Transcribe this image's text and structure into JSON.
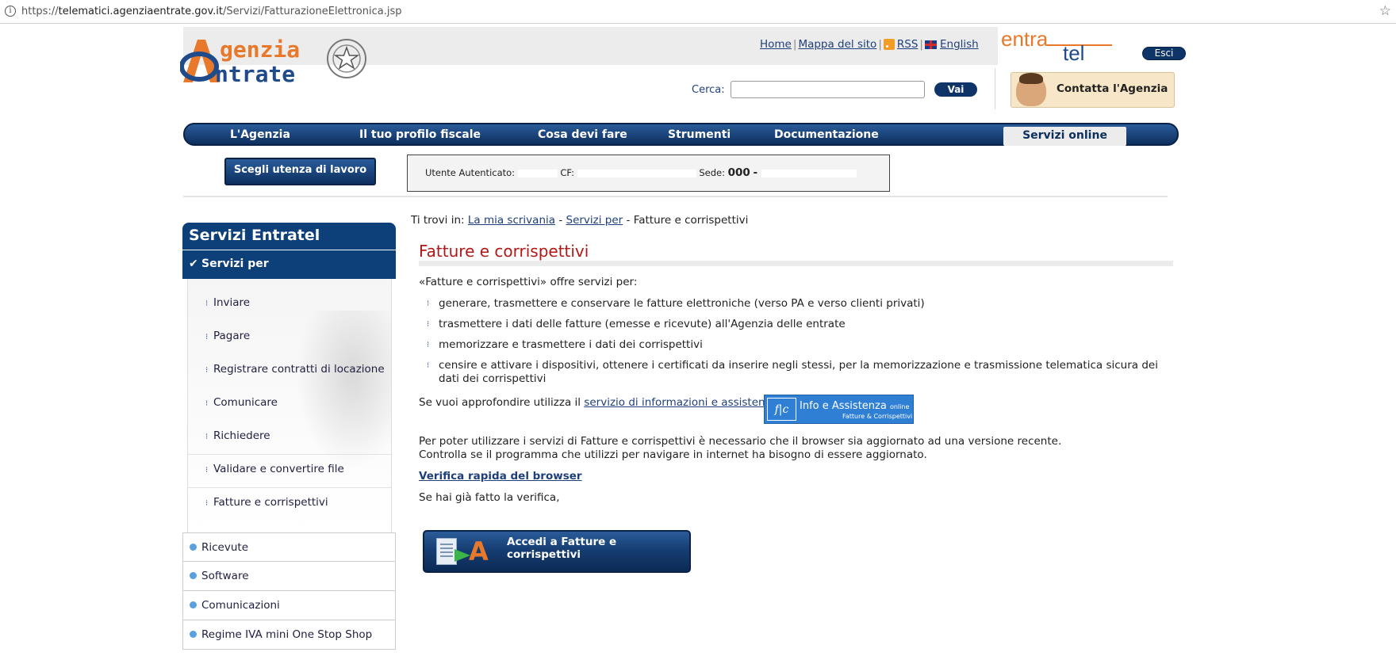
{
  "browser": {
    "url_scheme": "https://",
    "url_host": "telematici.agenziaentrate.gov.it",
    "url_path": "/Servizi/FatturazioneElettronica.jsp"
  },
  "logo": {
    "top": "genzia",
    "bottom": "ntrate"
  },
  "toplinks": {
    "home": "Home",
    "mappa": "Mappa del sito",
    "rss": "RSS",
    "english": "English"
  },
  "entratel": {
    "part1": "entra",
    "part2": "tel",
    "esci": "Esci"
  },
  "search": {
    "label": "Cerca:",
    "value": "",
    "button": "Vai"
  },
  "contatta": "Contatta l'Agenzia",
  "nav": {
    "items": [
      "L'Agenzia",
      "Il tuo profilo fiscale",
      "Cosa devi fare",
      "Strumenti",
      "Documentazione"
    ],
    "active": "Servizi online"
  },
  "scegli_button": "Scegli utenza di lavoro",
  "utente": {
    "label": "Utente Autenticato:",
    "cf_label": "CF:",
    "sede_label": "Sede:",
    "sede_value": "000"
  },
  "sidebar": {
    "title": "Servizi Entratel",
    "active": "Servizi per",
    "sub": [
      "Inviare",
      "Pagare",
      "Registrare contratti di locazione",
      "Comunicare",
      "Richiedere",
      "Validare e convertire file",
      "Fatture e corrispettivi"
    ],
    "list": [
      "Ricevute",
      "Software",
      "Comunicazioni",
      "Regime IVA mini One Stop Shop"
    ]
  },
  "breadcrumb": {
    "prefix": "Ti trovi in:",
    "link1": "La mia scrivania",
    "sep": "-",
    "link2": "Servizi per",
    "current": "Fatture e corrispettivi"
  },
  "page_title": "Fatture e corrispettivi",
  "content": {
    "intro": "«Fatture e corrispettivi» offre servizi per:",
    "bullets": [
      "generare, trasmettere e conservare le fatture elettroniche (verso PA e verso clienti privati)",
      "trasmettere i dati delle fatture (emesse e ricevute) all'Agenzia delle entrate",
      "memorizzare e trasmettere i dati dei corrispettivi",
      "censire e attivare i dispositivi, ottenere i certificati da inserire negli stessi, per la memorizzazione e trasmissione telematica sicura dei dati dei corrispettivi"
    ],
    "info_text": "Se vuoi approfondire utilizza il",
    "info_link": "servizio di informazioni e assistenza",
    "banner_title": "Info e Assistenza",
    "banner_online": "online",
    "banner_sub": "Fatture & Corrispettivi",
    "browser_line1": "Per poter utilizzare i servizi di Fatture e corrispettivi è necessario che il browser sia aggiornato ad una versione recente.",
    "browser_line2": "Controlla se il programma che utilizzi per navigare in internet ha bisogno di essere aggiornato.",
    "verifica": "Verifica rapida del browser",
    "gia": "Se hai già fatto la verifica,",
    "accedi": "Accedi a Fatture e corrispettivi"
  }
}
